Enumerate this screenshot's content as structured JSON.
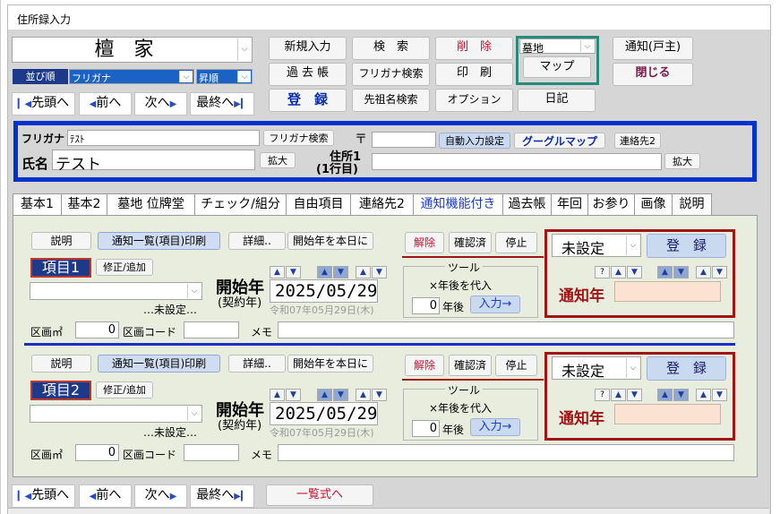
{
  "window": {
    "title": "住所録入力"
  },
  "header": {
    "family_name": "檀　家",
    "sort_label": "並び順",
    "sort_field": "フリガナ",
    "sort_order": "昇順",
    "nav": {
      "first": "先頭へ",
      "prev": "前へ",
      "next": "次へ",
      "last": "最終へ"
    },
    "buttons": {
      "new": "新規入力",
      "search": "検　索",
      "delete": "削　除",
      "past": "過 去 帳",
      "kana_search": "フリガナ検索",
      "print": "印　刷",
      "register": "登　録",
      "ancestor_search": "先祖名検索",
      "options": "オプション",
      "diary": "日記",
      "notify_head": "通知(戸主)",
      "close": "閉じる",
      "map": "マップ"
    },
    "grave_select": "墓地"
  },
  "person": {
    "furigana_label": "フリガナ",
    "furigana": "ﾃｽﾄ",
    "furigana_search": "フリガナ検索",
    "name_label": "氏名",
    "name": "テスト",
    "expand": "拡大",
    "postal_mark": "〒",
    "auto_input": "自動入力設定",
    "google_map": "グーグルマップ",
    "contact2": "連絡先2",
    "address_label": "住所1",
    "address_sub": "(1行目)",
    "address_expand": "拡大"
  },
  "tabs": [
    "基本1",
    "基本2",
    "墓地 位牌堂",
    "チェック/組分",
    "自由項目",
    "連絡先2",
    "通知機能付き",
    "過去帳",
    "年回",
    "お参り",
    "画像",
    "説明"
  ],
  "items": [
    {
      "explain": "説明",
      "list_print": "通知一覧(項目)印刷",
      "detail": "詳細..",
      "start_today": "開始年を本日に",
      "release": "解除",
      "confirmed": "確認済",
      "stop": "停止",
      "item_label": "項目1",
      "edit_add": "修正/追加",
      "unset_note": "…未設定…",
      "start_label": "開始年",
      "contract_label": "(契約年)",
      "date": "2025/05/29",
      "era": "令和07年05月29日(木)",
      "tool": "ツール",
      "years_later_sub": "×年後を代入",
      "years_value": "0",
      "years_unit": "年後",
      "input_btn": "入力→",
      "section_label": "区画㎡",
      "section_value": "0",
      "section_code": "区画コード",
      "memo": "メモ",
      "status": "未設定",
      "register": "登　録",
      "help": "?",
      "notify_year": "通知年"
    },
    {
      "explain": "説明",
      "list_print": "通知一覧(項目)印刷",
      "detail": "詳細..",
      "start_today": "開始年を本日に",
      "release": "解除",
      "confirmed": "確認済",
      "stop": "停止",
      "item_label": "項目2",
      "edit_add": "修正/追加",
      "unset_note": "…未設定…",
      "start_label": "開始年",
      "contract_label": "(契約年)",
      "date": "2025/05/29",
      "era": "令和07年05月29日(木)",
      "tool": "ツール",
      "years_later_sub": "×年後を代入",
      "years_value": "0",
      "years_unit": "年後",
      "input_btn": "入力→",
      "section_label": "区画㎡",
      "section_value": "0",
      "section_code": "区画コード",
      "memo": "メモ",
      "status": "未設定",
      "register": "登　録",
      "help": "?",
      "notify_year": "通知年"
    }
  ],
  "footer": {
    "first": "先頭へ",
    "prev": "前へ",
    "next": "次へ",
    "last": "最終へ",
    "list_view": "一覧式へ"
  }
}
